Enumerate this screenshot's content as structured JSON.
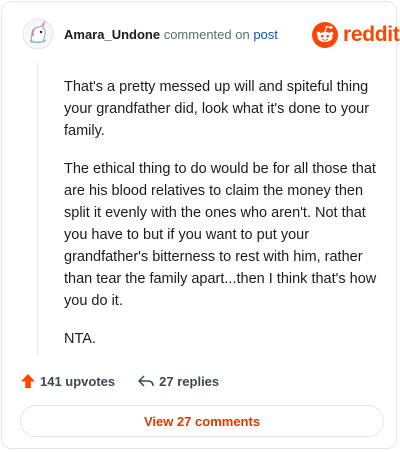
{
  "header": {
    "author": "Amara_Undone",
    "action_text": "commented on",
    "post_link": "post",
    "brand": "reddit"
  },
  "comment": {
    "paragraphs": [
      "That's a pretty messed up will and spiteful thing your grandfather did, look what it's done to your family.",
      "The ethical thing to do would be for all those that are his blood relatives to claim the money then split it evenly with the ones who aren't. Not that you have to but if you want to put your grandfather's bitterness to rest with him, rather than tear the family apart...then I think that's how you do it.",
      "NTA."
    ]
  },
  "actions": {
    "upvotes": "141 upvotes",
    "replies": "27 replies"
  },
  "footer": {
    "view_comments": "View 27 comments"
  },
  "colors": {
    "brand": "#ff4500",
    "link": "#0f55b4",
    "view_button": "#d93a00"
  },
  "icons": {
    "avatar": "snoo-unicorn-avatar",
    "logo": "reddit-snoo-icon",
    "upvote": "upvote-arrow-icon",
    "reply": "reply-arrow-icon"
  }
}
